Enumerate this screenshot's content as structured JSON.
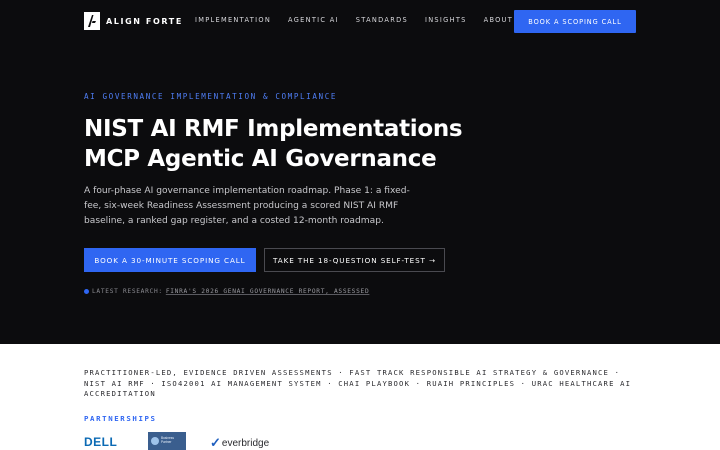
{
  "brand": {
    "name": "ALIGN FORTE"
  },
  "nav": {
    "links": [
      "IMPLEMENTATION",
      "AGENTIC AI",
      "STANDARDS",
      "INSIGHTS",
      "ABOUT"
    ],
    "cta": "BOOK A SCOPING CALL"
  },
  "hero": {
    "eyebrow": "AI GOVERNANCE IMPLEMENTATION & COMPLIANCE",
    "title_line1": "NIST AI RMF Implementations",
    "title_line2": "MCP Agentic AI Governance",
    "description": "A four-phase AI governance implementation roadmap. Phase 1: a fixed-fee, six-week Readiness Assessment producing a scored NIST AI RMF baseline, a ranked gap register, and a costed 12-month roadmap.",
    "primary_button": "BOOK A 30-MINUTE SCOPING CALL",
    "secondary_button": "TAKE THE 18-QUESTION SELF-TEST →",
    "research_prefix": "LATEST RESEARCH:",
    "research_link": "FINRA'S 2026 GENAI GOVERNANCE REPORT, ASSESSED"
  },
  "lower": {
    "tagline": "PRACTITIONER-LED, EVIDENCE DRIVEN ASSESSMENTS · FAST TRACK RESPONSIBLE AI STRATEGY & GOVERNANCE · NIST AI RMF · ISO42001 AI MANAGEMENT SYSTEM · CHAI PLAYBOOK · RUAIH PRINCIPLES · URAC HEALTHCARE AI ACCREDITATION",
    "partners_label": "PARTNERSHIPS",
    "partners": {
      "dell": "DELL",
      "hp_line1": "Business",
      "hp_line2": "Partner",
      "everbridge_mark": "✓",
      "everbridge": "everbridge"
    }
  },
  "colors": {
    "background": "#0c0c0e",
    "accent": "#2f66f2",
    "lower_background": "#ffffff"
  }
}
